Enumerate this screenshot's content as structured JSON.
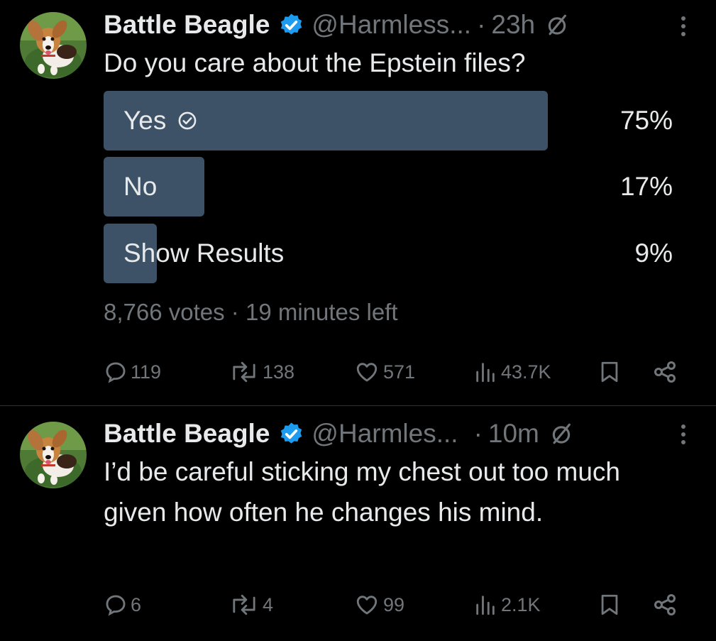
{
  "colors": {
    "background": "#000000",
    "text_primary": "#e7e9ea",
    "text_secondary": "#71767b",
    "verified_blue": "#1d9bf0",
    "poll_bar": "#3d5266",
    "divider": "#2f3336"
  },
  "tweets": [
    {
      "author": {
        "display_name": "Battle Beagle",
        "handle": "@Harmless...",
        "verified": true,
        "avatar_icon": "beagle-avatar"
      },
      "separator": "·",
      "time": "23h",
      "text": "Do you care about the Epstein files?",
      "poll": {
        "options": [
          {
            "label": "Yes",
            "percent_text": "75%",
            "fraction": 0.75,
            "selected": true
          },
          {
            "label": "No",
            "percent_text": "17%",
            "fraction": 0.17,
            "selected": false
          },
          {
            "label": "Show Results",
            "percent_text": "9%",
            "fraction": 0.09,
            "selected": false
          }
        ],
        "votes": "8,766 votes",
        "separator": "·",
        "time_left": "19 minutes left"
      },
      "actions": {
        "replies": "119",
        "reposts": "138",
        "likes": "571",
        "views": "43.7K"
      }
    },
    {
      "author": {
        "display_name": "Battle Beagle",
        "handle": "@Harmles...",
        "verified": true,
        "avatar_icon": "beagle-avatar"
      },
      "separator": "·",
      "time": "10m",
      "text": "I’d be careful sticking my chest out too much given how often he changes his mind.",
      "actions": {
        "replies": "6",
        "reposts": "4",
        "likes": "99",
        "views": "2.1K"
      }
    }
  ]
}
